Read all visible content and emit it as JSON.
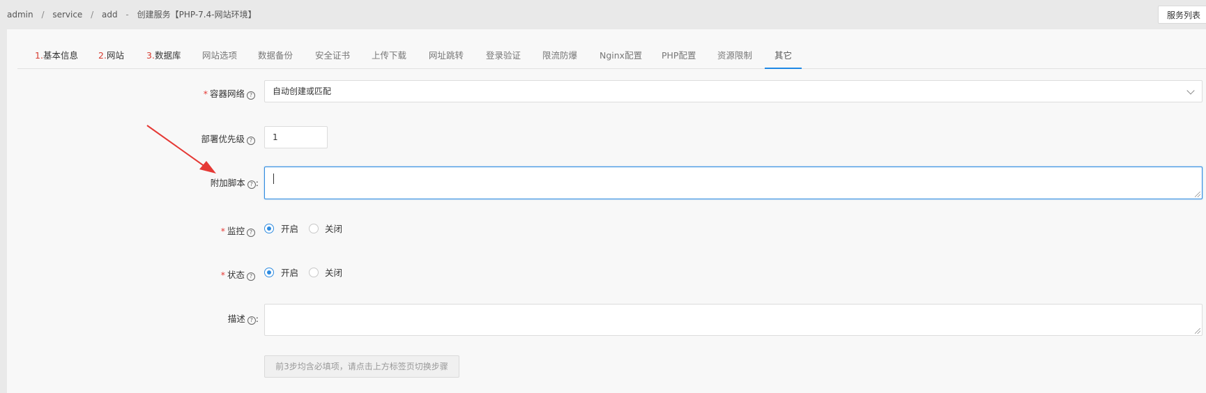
{
  "breadcrumb": {
    "items": [
      "admin",
      "service",
      "add"
    ],
    "current": "创建服务【PHP-7.4-网站环境】",
    "separator": "/",
    "dash": "-"
  },
  "header": {
    "service_list_button": "服务列表"
  },
  "tabs": [
    {
      "num": "1.",
      "label": "基本信息"
    },
    {
      "num": "2.",
      "label": "网站"
    },
    {
      "num": "3.",
      "label": "数据库"
    },
    {
      "num": "",
      "label": "网站选项"
    },
    {
      "num": "",
      "label": "数据备份"
    },
    {
      "num": "",
      "label": "安全证书"
    },
    {
      "num": "",
      "label": "上传下载"
    },
    {
      "num": "",
      "label": "网址跳转"
    },
    {
      "num": "",
      "label": "登录验证"
    },
    {
      "num": "",
      "label": "限流防爆"
    },
    {
      "num": "",
      "label": "Nginx配置"
    },
    {
      "num": "",
      "label": "PHP配置"
    },
    {
      "num": "",
      "label": "资源限制"
    },
    {
      "num": "",
      "label": "其它"
    }
  ],
  "active_tab": "其它",
  "form": {
    "network": {
      "label": "容器网络",
      "required": "*",
      "value": "自动创建或匹配"
    },
    "priority": {
      "label": "部署优先级",
      "value": "1"
    },
    "script": {
      "label": "附加脚本",
      "colon": ":",
      "value": ""
    },
    "monitor": {
      "label": "监控",
      "required": "*",
      "on": "开启",
      "off": "关闭",
      "selected": "开启"
    },
    "status": {
      "label": "状态",
      "required": "*",
      "on": "开启",
      "off": "关闭",
      "selected": "开启"
    },
    "description": {
      "label": "描述",
      "colon": ":",
      "value": ""
    },
    "submit_hint": "前3步均含必填项，请点击上方标签页切换步骤"
  },
  "help_glyph": "?",
  "colors": {
    "accent": "#1e88e5",
    "required": "#e53935",
    "annotation_arrow": "#e53935"
  }
}
